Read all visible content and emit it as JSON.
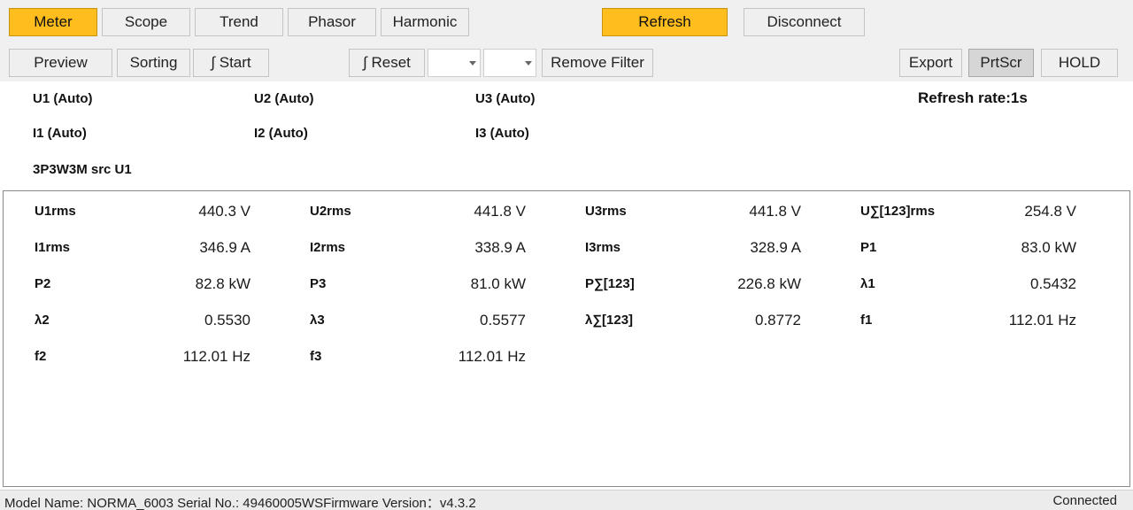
{
  "tabs": {
    "meter": "Meter",
    "scope": "Scope",
    "trend": "Trend",
    "phasor": "Phasor",
    "harmonic": "Harmonic"
  },
  "actions": {
    "refresh": "Refresh",
    "disconnect": "Disconnect"
  },
  "toolbar2": {
    "preview": "Preview",
    "sorting": "Sorting",
    "start": "∫ Start",
    "reset": "∫ Reset",
    "combo1": "",
    "combo2": "",
    "remove_filter": "Remove Filter",
    "export": "Export",
    "prtscr": "PrtScr",
    "hold": "HOLD"
  },
  "channels": {
    "u1": "U1 (Auto)",
    "u2": "U2 (Auto)",
    "u3": "U3 (Auto)",
    "i1": "I1 (Auto)",
    "i2": "I2 (Auto)",
    "i3": "I3 (Auto)",
    "wiring": "3P3W3M src U1"
  },
  "refresh_rate": "Refresh rate:1s",
  "meter_rows": [
    [
      {
        "label": "U1rms",
        "value": "440.3 V"
      },
      {
        "label": "U2rms",
        "value": "441.8 V"
      },
      {
        "label": "U3rms",
        "value": "441.8 V"
      },
      {
        "label": "U∑[123]rms",
        "value": "254.8 V"
      }
    ],
    [
      {
        "label": "I1rms",
        "value": "346.9 A"
      },
      {
        "label": "I2rms",
        "value": "338.9 A"
      },
      {
        "label": "I3rms",
        "value": "328.9 A"
      },
      {
        "label": "P1",
        "value": "83.0 kW"
      }
    ],
    [
      {
        "label": "P2",
        "value": "82.8 kW"
      },
      {
        "label": "P3",
        "value": "81.0 kW"
      },
      {
        "label": "P∑[123]",
        "value": "226.8 kW"
      },
      {
        "label": "λ1",
        "value": "0.5432"
      }
    ],
    [
      {
        "label": "λ2",
        "value": "0.5530"
      },
      {
        "label": "λ3",
        "value": "0.5577"
      },
      {
        "label": "λ∑[123]",
        "value": "0.8772"
      },
      {
        "label": "f1",
        "value": "112.01 Hz"
      }
    ],
    [
      {
        "label": "f2",
        "value": "112.01 Hz"
      },
      {
        "label": "f3",
        "value": "112.01 Hz"
      }
    ]
  ],
  "status": {
    "device_info": "Model Name:  NORMA_6003 Serial No.:  49460005WSFirmware Version：v4.3.2",
    "connection": "Connected"
  },
  "colors": {
    "active_tab": "#ffbd1e",
    "toolbar_bg": "#f0f0f0"
  }
}
